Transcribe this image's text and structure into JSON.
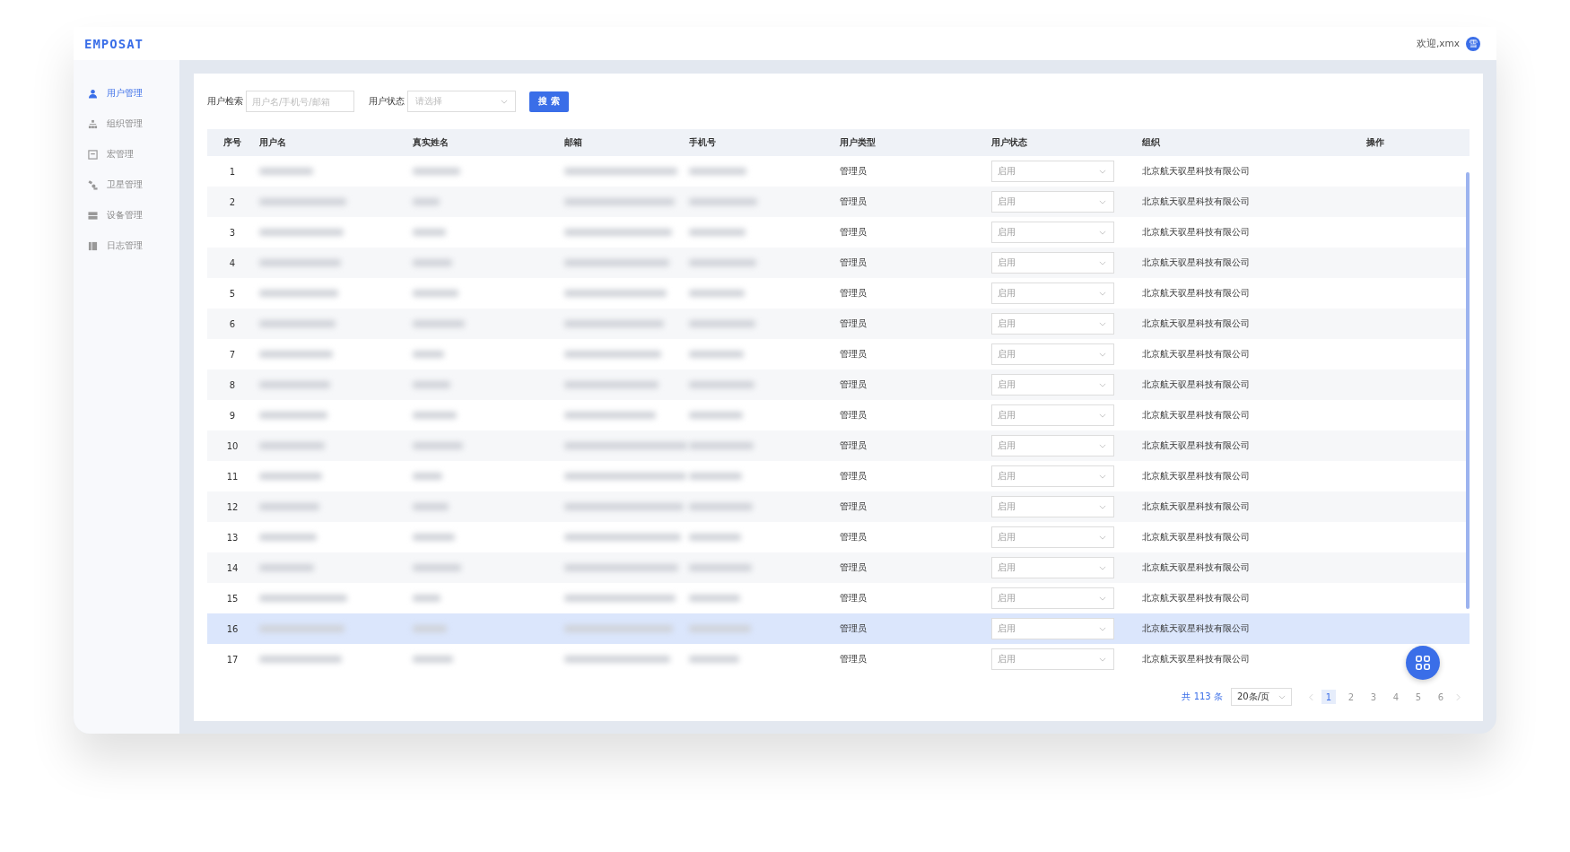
{
  "header": {
    "logo": "EMPOSAT",
    "greeting": "欢迎,xmx",
    "avatar": "雪"
  },
  "sidebar": {
    "items": [
      {
        "label": "用户管理",
        "selected": true
      },
      {
        "label": "组织管理",
        "selected": false
      },
      {
        "label": "宏管理",
        "selected": false
      },
      {
        "label": "卫星管理",
        "selected": false
      },
      {
        "label": "设备管理",
        "selected": false
      },
      {
        "label": "日志管理",
        "selected": false
      }
    ]
  },
  "filters": {
    "search_label": "用户检索",
    "search_placeholder": "用户名/手机号/邮箱",
    "status_label": "用户状态",
    "status_placeholder": "请选择",
    "button": "搜 索"
  },
  "table": {
    "columns": [
      "序号",
      "用户名",
      "真实姓名",
      "邮箱",
      "手机号",
      "用户类型",
      "用户状态",
      "组织",
      "操作"
    ],
    "rows": [
      {
        "index": "1",
        "user_type": "管理员",
        "status": "启用",
        "org": "北京航天驭星科技有限公司",
        "selected": false
      },
      {
        "index": "2",
        "user_type": "管理员",
        "status": "启用",
        "org": "北京航天驭星科技有限公司",
        "selected": false
      },
      {
        "index": "3",
        "user_type": "管理员",
        "status": "启用",
        "org": "北京航天驭星科技有限公司",
        "selected": false
      },
      {
        "index": "4",
        "user_type": "管理员",
        "status": "启用",
        "org": "北京航天驭星科技有限公司",
        "selected": false
      },
      {
        "index": "5",
        "user_type": "管理员",
        "status": "启用",
        "org": "北京航天驭星科技有限公司",
        "selected": false
      },
      {
        "index": "6",
        "user_type": "管理员",
        "status": "启用",
        "org": "北京航天驭星科技有限公司",
        "selected": false
      },
      {
        "index": "7",
        "user_type": "管理员",
        "status": "启用",
        "org": "北京航天驭星科技有限公司",
        "selected": false
      },
      {
        "index": "8",
        "user_type": "管理员",
        "status": "启用",
        "org": "北京航天驭星科技有限公司",
        "selected": false
      },
      {
        "index": "9",
        "user_type": "管理员",
        "status": "启用",
        "org": "北京航天驭星科技有限公司",
        "selected": false
      },
      {
        "index": "10",
        "user_type": "管理员",
        "status": "启用",
        "org": "北京航天驭星科技有限公司",
        "selected": false
      },
      {
        "index": "11",
        "user_type": "管理员",
        "status": "启用",
        "org": "北京航天驭星科技有限公司",
        "selected": false
      },
      {
        "index": "12",
        "user_type": "管理员",
        "status": "启用",
        "org": "北京航天驭星科技有限公司",
        "selected": false
      },
      {
        "index": "13",
        "user_type": "管理员",
        "status": "启用",
        "org": "北京航天驭星科技有限公司",
        "selected": false
      },
      {
        "index": "14",
        "user_type": "管理员",
        "status": "启用",
        "org": "北京航天驭星科技有限公司",
        "selected": false
      },
      {
        "index": "15",
        "user_type": "管理员",
        "status": "启用",
        "org": "北京航天驭星科技有限公司",
        "selected": false
      },
      {
        "index": "16",
        "user_type": "管理员",
        "status": "启用",
        "org": "北京航天驭星科技有限公司",
        "selected": true
      },
      {
        "index": "17",
        "user_type": "管理员",
        "status": "启用",
        "org": "北京航天驭星科技有限公司",
        "selected": false
      }
    ]
  },
  "pagination": {
    "total": "共 113 条",
    "page_size": "20条/页",
    "pages": [
      {
        "label": "1",
        "selected": true
      },
      {
        "label": "2",
        "selected": false
      },
      {
        "label": "3",
        "selected": false
      },
      {
        "label": "4",
        "selected": false
      },
      {
        "label": "5",
        "selected": false
      },
      {
        "label": "6",
        "selected": false
      }
    ]
  }
}
